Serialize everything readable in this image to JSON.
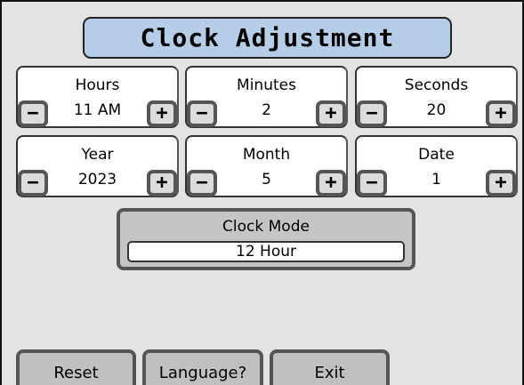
{
  "title": "Clock Adjustment",
  "controls": [
    {
      "label": "Hours",
      "value": "11 AM",
      "minus": "−",
      "plus": "+"
    },
    {
      "label": "Minutes",
      "value": "2",
      "minus": "−",
      "plus": "+"
    },
    {
      "label": "Seconds",
      "value": "20",
      "minus": "−",
      "plus": "+"
    },
    {
      "label": "Year",
      "value": "2023",
      "minus": "−",
      "plus": "+"
    },
    {
      "label": "Month",
      "value": "5",
      "minus": "−",
      "plus": "+"
    },
    {
      "label": "Date",
      "value": "1",
      "minus": "−",
      "plus": "+"
    }
  ],
  "clock_mode": {
    "label": "Clock Mode",
    "value": "12 Hour"
  },
  "buttons": {
    "reset": "Reset",
    "language": "Language?",
    "exit": "Exit"
  },
  "colors": {
    "title_bg": "#b5cde6",
    "background": "#e3e3e3",
    "button_border": "#555555"
  }
}
